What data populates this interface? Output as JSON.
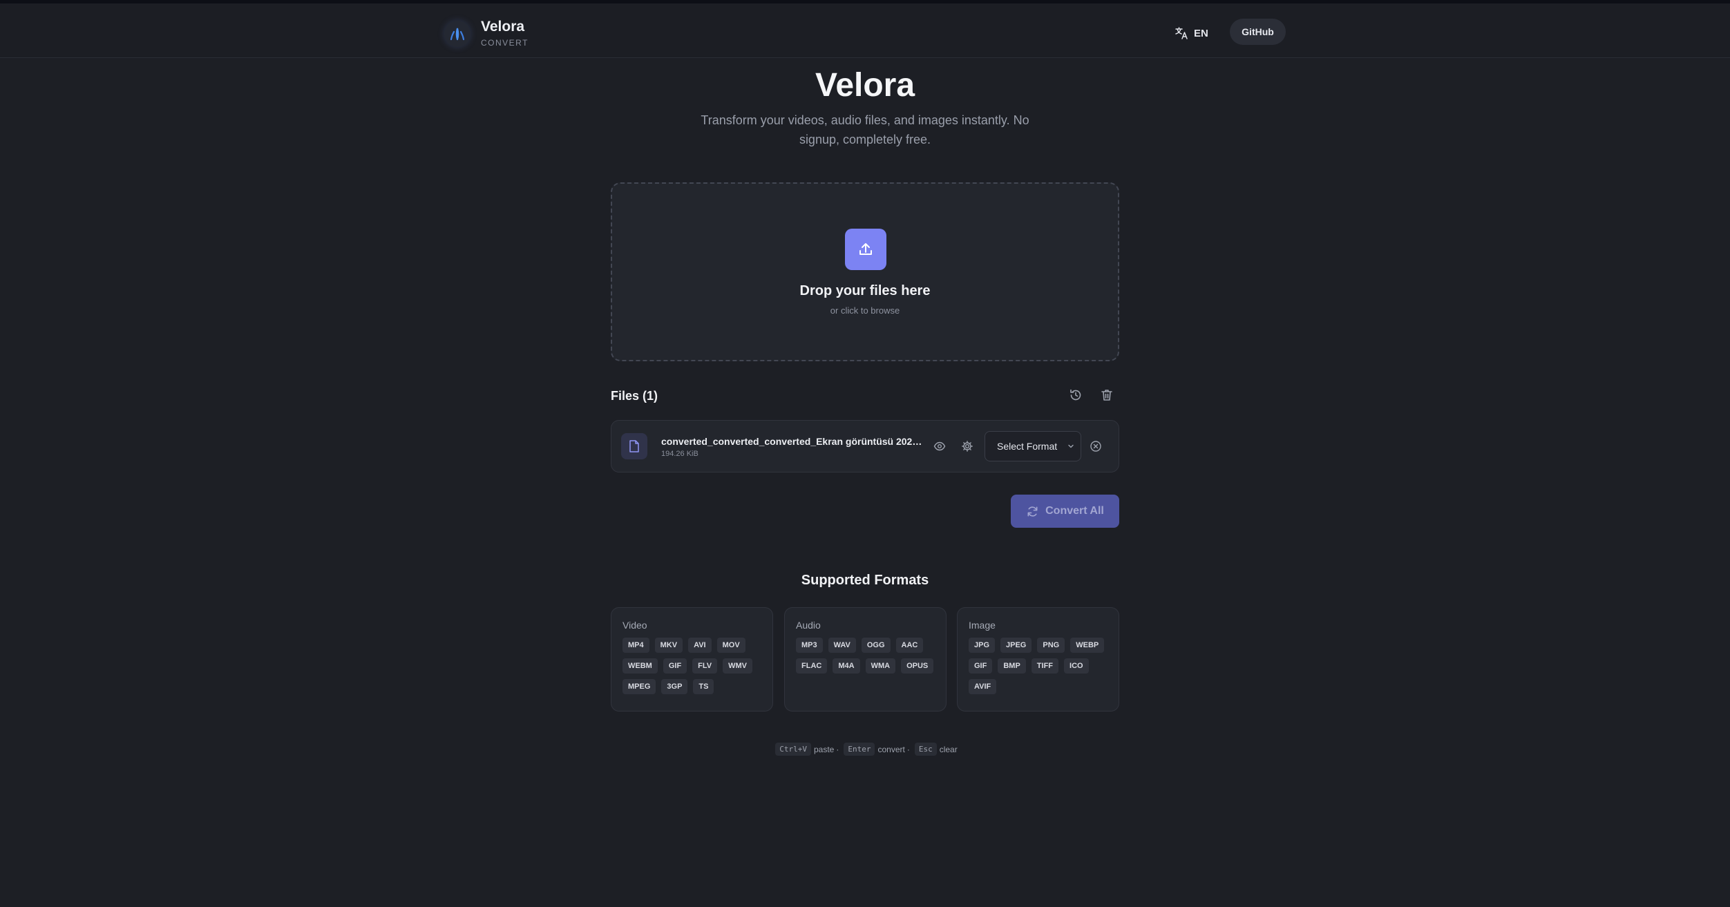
{
  "header": {
    "brand_name": "Velora",
    "brand_sub": "CONVERT",
    "language": "EN",
    "github_label": "GitHub"
  },
  "hero": {
    "title": "Velora",
    "subtitle": "Transform your videos, audio files, and images instantly. No signup, completely free."
  },
  "dropzone": {
    "title": "Drop your files here",
    "subtitle": "or click to browse"
  },
  "files": {
    "title": "Files (1)",
    "items": [
      {
        "name": "converted_converted_converted_Ekran görüntüsü 2025-1...",
        "size": "194.26 KiB",
        "format_placeholder": "Select Format"
      }
    ],
    "convert_all_label": "Convert All"
  },
  "formats": {
    "title": "Supported Formats",
    "categories": [
      {
        "name": "Video",
        "items": [
          "MP4",
          "MKV",
          "AVI",
          "MOV",
          "WEBM",
          "GIF",
          "FLV",
          "WMV",
          "MPEG",
          "3GP",
          "TS"
        ]
      },
      {
        "name": "Audio",
        "items": [
          "MP3",
          "WAV",
          "OGG",
          "AAC",
          "FLAC",
          "M4A",
          "WMA",
          "OPUS"
        ]
      },
      {
        "name": "Image",
        "items": [
          "JPG",
          "JPEG",
          "PNG",
          "WEBP",
          "GIF",
          "BMP",
          "TIFF",
          "ICO",
          "AVIF"
        ]
      }
    ]
  },
  "shortcuts": [
    {
      "key": "Ctrl+V",
      "action": "paste"
    },
    {
      "key": "Enter",
      "action": "convert"
    },
    {
      "key": "Esc",
      "action": "clear"
    }
  ],
  "colors": {
    "accent": "#7c83f3",
    "background": "#1d1f25",
    "card": "#23262d",
    "convert_button": "#4e54a0"
  },
  "icons": {
    "logo": "flame-logo-icon",
    "language": "translate-icon",
    "upload": "upload-icon",
    "history": "history-icon",
    "trash": "trash-icon",
    "file": "file-icon",
    "preview": "eye-icon",
    "settings": "gear-icon",
    "remove": "close-circle-icon",
    "convert": "refresh-icon"
  }
}
